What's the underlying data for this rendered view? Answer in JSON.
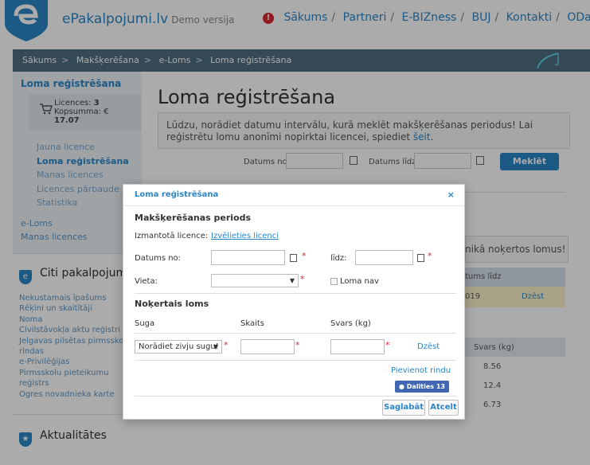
{
  "header": {
    "brand": "ePakalpojumi.lv",
    "demo": "Demo versija",
    "alert_icon": "!",
    "nav": [
      "Sākums",
      "Partneri",
      "E-BIZness",
      "BUJ",
      "Kontakti",
      "OData"
    ],
    "separator": "/"
  },
  "breadcrumb": {
    "items": [
      "Sākums",
      "Makšķerēšana",
      "e-Loms",
      "Loma reģistrēšana"
    ],
    "separator": ">"
  },
  "sidebar": {
    "title": "Loma reģistrēšana",
    "cart": {
      "licences_label": "Licences:",
      "licences_value": "3",
      "total_label": "Kopsumma: €",
      "total_value": "17.07"
    },
    "menu": [
      "Jauna licence",
      "Loma reģistrēšana",
      "Manas licences",
      "Licences pārbaude",
      "Statistika"
    ],
    "links": [
      "e-Loms",
      "Manas licences"
    ],
    "other_title": "Citi pakalpojumi",
    "other_icon": "e",
    "other_items": [
      "Nekustamais īpašums",
      "Rēķini un skaitītāji",
      "Noma",
      "Civilstāvokļa aktu reģistri",
      "Jelgavas pilsētas pirmsskolu",
      "rindas",
      "e-Privilēģijas",
      "Pirmsskolu pieteikumu",
      "reģistrs",
      "Ogres novadnieka karte"
    ],
    "news_title": "Aktualitātes",
    "news_icon": "★"
  },
  "main": {
    "title": "Loma reģistrēšana",
    "info_text": "Lūdzu, norādiet datumu intervālu, kurā meklēt makšķerēšanas periodus! Lai reģistrētu lomu anonīmi nopirktai licencei, spiediet",
    "info_link": "šeit",
    "info_end": ".",
    "date_from_label": "Datums no:",
    "date_to_label": "Datums līdz:",
    "search_button": "Meklēt",
    "bg_notice": "nikā noķertos lomus!",
    "bg_col": "tums līdz",
    "bg_date_frag": "019",
    "bg_delete": "Dzēst",
    "bg_weight_header": "Svars (kg)",
    "bg_weights": [
      "8.56",
      "12.4",
      "6.73"
    ]
  },
  "modal": {
    "title": "Loma reģistrēšana",
    "close": "×",
    "period_heading": "Makšķerēšanas periods",
    "licence_label": "Izmantotā licence:",
    "licence_link": "Izvēlieties licenci",
    "date_from_label": "Datums no:",
    "date_to_label": "līdz:",
    "place_label": "Vieta:",
    "place_value": "",
    "no_catch_label": "Loma nav",
    "catch_heading": "Noķertais loms",
    "col_species": "Suga",
    "col_count": "Skaits",
    "col_weight": "Svars (kg)",
    "species_placeholder": "Norādiet zivju sugu!",
    "delete": "Dzēst",
    "add_row": "Pievienot rindu",
    "fb_share": "Dalīties 13",
    "save": "Saglabāt",
    "cancel": "Atcelt",
    "required_mark": "*"
  },
  "colors": {
    "primary": "#2a86c8",
    "crumb_bar": "#4f6e82",
    "required": "#d7282f",
    "facebook": "#4267b2"
  }
}
